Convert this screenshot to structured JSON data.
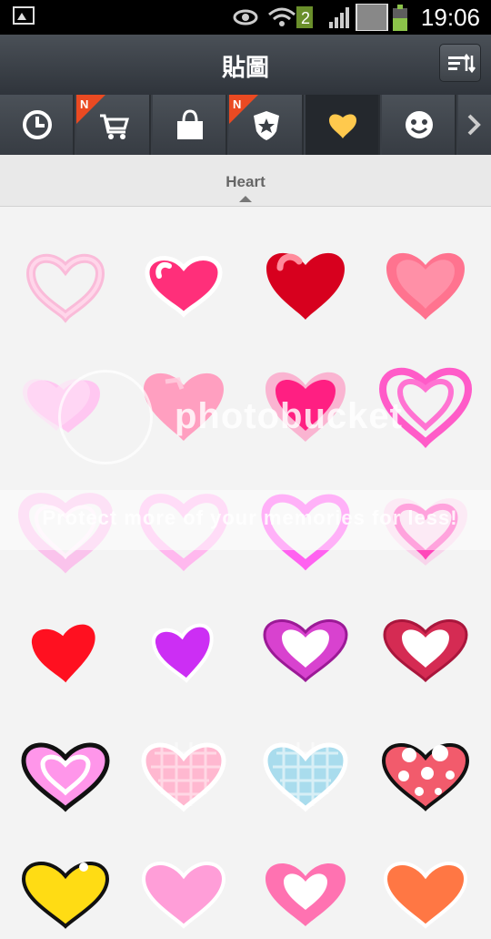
{
  "status_bar": {
    "time": "19:06",
    "sim_badge": "2",
    "icons": [
      "gallery-notification-icon",
      "eye-icon",
      "wifi-icon",
      "signal-icon",
      "battery-icon"
    ]
  },
  "header": {
    "title": "貼圖",
    "sort_button": "sort-icon"
  },
  "tabs": [
    {
      "icon": "clock-icon",
      "new": false
    },
    {
      "icon": "cart-icon",
      "new": true,
      "badge": "N"
    },
    {
      "icon": "bag-icon",
      "new": false
    },
    {
      "icon": "shield-star-icon",
      "new": true,
      "badge": "N"
    },
    {
      "icon": "heart-icon",
      "new": false,
      "active": true
    },
    {
      "icon": "face-icon",
      "new": false
    },
    {
      "icon": "chevron-right-icon",
      "new": false
    }
  ],
  "category": {
    "label": "Heart"
  },
  "watermark": {
    "brand": "photobucket",
    "text": "Protect more of your memories for less!"
  },
  "stickers": [
    {
      "style": "outline",
      "color": "#ff5f9f"
    },
    {
      "style": "glossy",
      "color": "#ff2f7a"
    },
    {
      "style": "glossy",
      "color": "#d9001f"
    },
    {
      "style": "glossy",
      "color": "#ff6f91"
    },
    {
      "style": "double",
      "color": "#ffb3e6"
    },
    {
      "style": "soft",
      "color": "#ff8fb4"
    },
    {
      "style": "glow",
      "color": "#ff2f8f"
    },
    {
      "style": "swirl",
      "color": "#f54fc7"
    },
    {
      "style": "neon",
      "color": "#ff67d8"
    },
    {
      "style": "neon",
      "color": "#ff7be2"
    },
    {
      "style": "neon",
      "color": "#ff56eb"
    },
    {
      "style": "neon",
      "color": "#ff49b7"
    },
    {
      "style": "flat",
      "color": "#ff0c1f"
    },
    {
      "style": "flat",
      "color": "#cb31f2"
    },
    {
      "style": "ring",
      "color": "#b629b8"
    },
    {
      "style": "ring",
      "color": "#d62d5d"
    },
    {
      "style": "outlined",
      "color": "#ff8ee8"
    },
    {
      "style": "plaid",
      "color": "#ffb6cf"
    },
    {
      "style": "plaid",
      "color": "#a9ddec"
    },
    {
      "style": "dots",
      "color": "#f15a6c"
    },
    {
      "style": "partial",
      "color": "#ffd91f"
    },
    {
      "style": "partial",
      "color": "#ff9ed8"
    },
    {
      "style": "partial",
      "color": "#ff72b1"
    },
    {
      "style": "partial",
      "color": "#ff7a44"
    }
  ]
}
